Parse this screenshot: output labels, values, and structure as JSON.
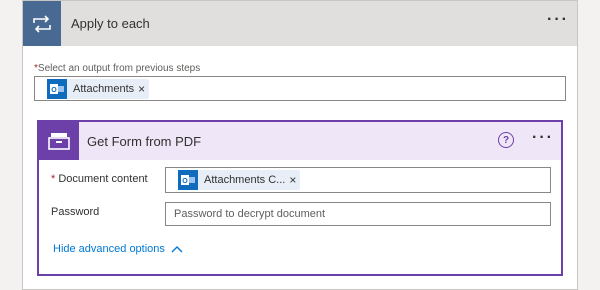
{
  "apply_to_each": {
    "title": "Apply to each",
    "more_label": "···",
    "required_mark": "*",
    "select_label": "Select an output from previous steps",
    "token": {
      "label": "Attachments",
      "remove": "×",
      "icon": "outlook-icon"
    }
  },
  "action": {
    "title": "Get Form from PDF",
    "help_label": "?",
    "more_label": "···",
    "document_content": {
      "required_mark": "*",
      "label": "Document content",
      "token": {
        "label": "Attachments C...",
        "remove": "×",
        "icon": "outlook-icon"
      }
    },
    "password": {
      "label": "Password",
      "placeholder": "Password to decrypt document"
    },
    "advanced_options": {
      "label": "Hide advanced options",
      "icon": "chevron-up-icon"
    }
  },
  "colors": {
    "loop_accent": "#486991",
    "action_accent": "#6d3fa8",
    "link": "#0078d4",
    "outlook_blue": "#0f6cbd"
  }
}
